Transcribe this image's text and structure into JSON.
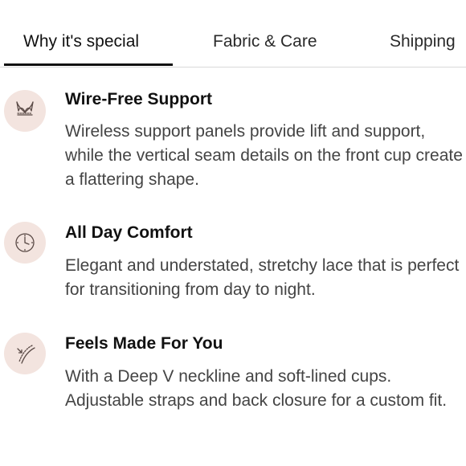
{
  "tabs": [
    {
      "label": "Why it's special",
      "active": true
    },
    {
      "label": "Fabric & Care",
      "active": false
    },
    {
      "label": "Shipping",
      "active": false
    }
  ],
  "features": [
    {
      "icon": "bra-icon",
      "title": "Wire-Free Support",
      "text": "Wireless support panels provide lift and support, while the vertical seam details on the front cup create a flattering shape."
    },
    {
      "icon": "clock-icon",
      "title": "All Day Comfort",
      "text": "Elegant and understated, stretchy lace that is perfect for transitioning from day to night."
    },
    {
      "icon": "measuring-tape-icon",
      "title": "Feels Made For You",
      "text": "With a Deep V neckline and soft-lined cups. Adjustable straps and back closure for a custom fit."
    }
  ],
  "colors": {
    "icon_background": "#f3e4df",
    "active_tab_underline": "#111111",
    "divider": "#d9d9d9",
    "body_text": "#444444"
  }
}
